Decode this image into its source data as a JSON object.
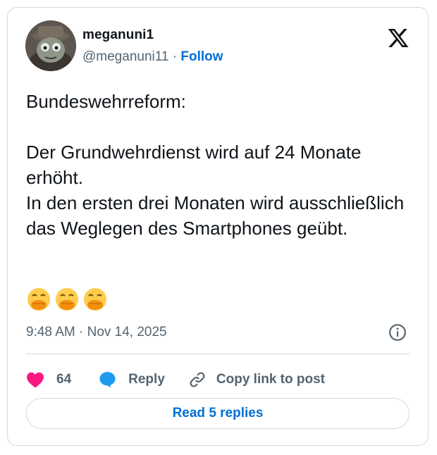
{
  "author": {
    "display_name": "meganuni1",
    "handle": "@meganuni11",
    "separator": " · ",
    "follow_label": "Follow"
  },
  "tweet": {
    "text": "Bundeswehrreform:\n\nDer Grundwehrdienst wird auf 24 Monate erhöht.\nIn den ersten drei Monaten wird ausschließlich das Weglegen des Smartphones geübt.",
    "emojis": [
      "🤭",
      "🤭",
      "🤭"
    ],
    "timestamp": "9:48 AM · Nov 14, 2025"
  },
  "actions": {
    "like_count": "64",
    "reply_label": "Reply",
    "copy_link_label": "Copy link to post"
  },
  "footer": {
    "read_replies_label": "Read 5 replies"
  },
  "colors": {
    "accent": "#006fd6",
    "like": "#f91880",
    "reply_bubble": "#1d9bf0",
    "muted": "#536471",
    "text": "#0f1419",
    "border": "#cfd9de"
  },
  "icons": [
    "x-logo-icon",
    "info-icon",
    "heart-icon",
    "reply-bubble-icon",
    "link-icon",
    "hand-over-mouth-emoji"
  ]
}
